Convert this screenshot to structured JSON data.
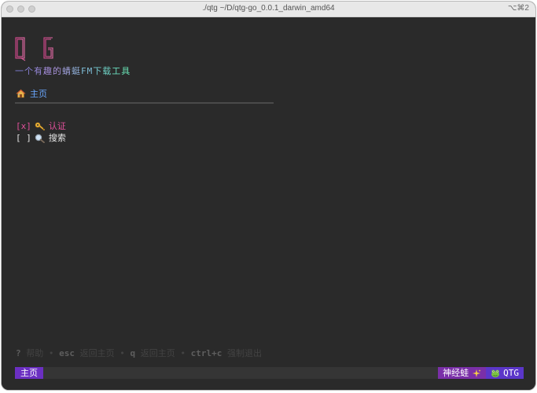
{
  "window": {
    "title": "./qtg ~/D/qtg-go_0.0.1_darwin_amd64",
    "shortcut": "⌥⌘2"
  },
  "header": {
    "logo_text": "QTG",
    "subtitle_chars": [
      "一",
      "个",
      "有",
      "趣",
      "的",
      "蜻",
      "蜓",
      "FM",
      "下",
      "载",
      "工",
      "具"
    ],
    "subtitle_colors": [
      "#7f7fd6",
      "#8a82d8",
      "#9687d8",
      "#a38cd9",
      "#a893da",
      "#9fa0da",
      "#90aed8",
      "#7fbcd6",
      "#74c8cf",
      "#6ed2c5",
      "#6ad9bb",
      "#68dfb3"
    ],
    "accent": "#e0509a"
  },
  "nav": {
    "icon": "home-icon",
    "label": "主页"
  },
  "menu": {
    "items": [
      {
        "checkbox": "[x]",
        "icon": "key-icon",
        "label": "认证",
        "active": true
      },
      {
        "checkbox": "[ ]",
        "icon": "magnifier-icon",
        "label": "搜索",
        "active": false
      }
    ]
  },
  "help": {
    "items": [
      {
        "key": "?",
        "desc": "帮助"
      },
      {
        "key": "esc",
        "desc": "返回主页"
      },
      {
        "key": "q",
        "desc": "返回主页"
      },
      {
        "key": "ctrl+c",
        "desc": "强制退出"
      }
    ],
    "separator": "•"
  },
  "statusbar": {
    "left_label": "主页",
    "right_badge_1": "神经蛙",
    "right_badge_1_icon": "sparkles-icon",
    "right_badge_2_icon": "frog-icon",
    "right_badge_2": "QTG"
  }
}
